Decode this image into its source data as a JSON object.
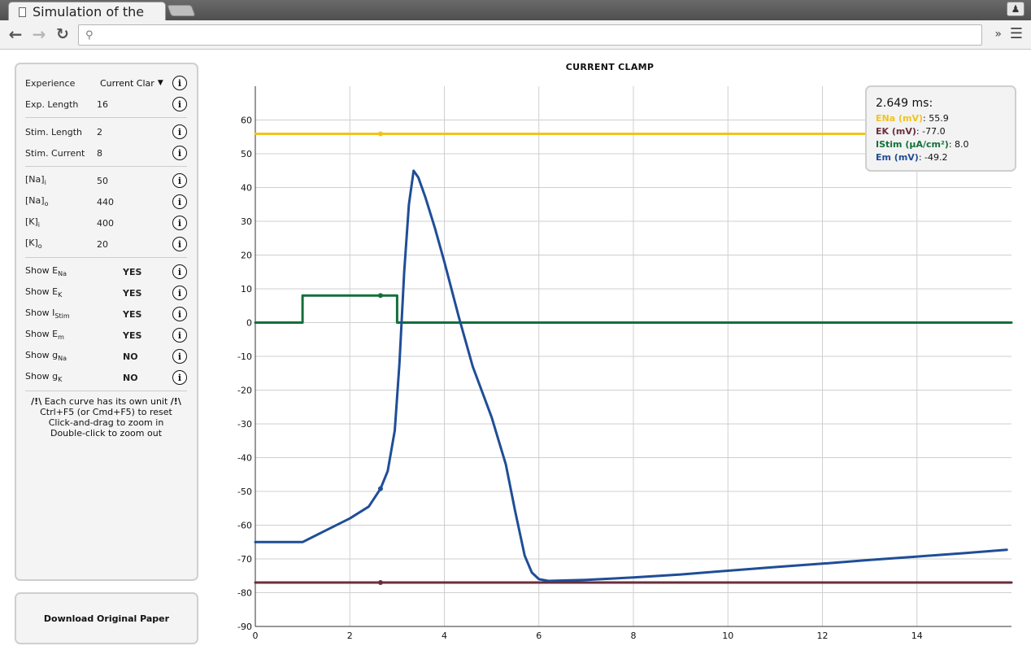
{
  "browser": {
    "tab_title": "Simulation of the ",
    "address_value": "",
    "overflow_label": "»"
  },
  "panel": {
    "experience": {
      "label": "Experience",
      "value": "Current Clar"
    },
    "exp_length": {
      "label": "Exp. Length",
      "value": "16"
    },
    "stim_length": {
      "label": "Stim. Length",
      "value": "2"
    },
    "stim_current": {
      "label": "Stim. Current",
      "value": "8"
    },
    "na_i": {
      "label": "[Na]",
      "sub": "i",
      "value": "50"
    },
    "na_o": {
      "label": "[Na]",
      "sub": "o",
      "value": "440"
    },
    "k_i": {
      "label": "[K]",
      "sub": "i",
      "value": "400"
    },
    "k_o": {
      "label": "[K]",
      "sub": "o",
      "value": "20"
    },
    "show_ena": {
      "label": "Show E",
      "sub": "Na",
      "value": "YES"
    },
    "show_ek": {
      "label": "Show E",
      "sub": "K",
      "value": "YES"
    },
    "show_istim": {
      "label": "Show I",
      "sub": "Stim",
      "value": "YES"
    },
    "show_em": {
      "label": "Show E",
      "sub": "m",
      "value": "YES"
    },
    "show_gna": {
      "label": "Show g",
      "sub": "Na",
      "value": "NO"
    },
    "show_gk": {
      "label": "Show g",
      "sub": "K",
      "value": "NO"
    },
    "notes": {
      "line1_mark_left": "/!\\",
      "line1_text": " Each curve has its own unit ",
      "line1_mark_right": "/!\\",
      "line2": "Ctrl+F5 (or Cmd+F5) to reset",
      "line3": "Click-and-drag to zoom in",
      "line4": "Double-click to zoom out"
    },
    "info_glyph": "i"
  },
  "download_label": "Download Original Paper",
  "tooltip": {
    "time": "2.649 ms:",
    "rows": [
      {
        "key": "ENa (mV)",
        "value": "55.9",
        "color": "#f2c31c"
      },
      {
        "key": "EK (mV)",
        "value": "-77.0",
        "color": "#6b2e3a"
      },
      {
        "key": "IStim (µA/cm²)",
        "value": "8.0",
        "color": "#13703a"
      },
      {
        "key": "Em (mV)",
        "value": "-49.2",
        "color": "#1f4e96"
      }
    ]
  },
  "chart_data": {
    "type": "line",
    "title": "CURRENT CLAMP",
    "xlabel": "",
    "ylabel": "",
    "xlim": [
      0,
      16
    ],
    "ylim": [
      -90,
      70
    ],
    "xticks": [
      0,
      2,
      4,
      6,
      8,
      10,
      12,
      14
    ],
    "yticks": [
      -90,
      -80,
      -70,
      -60,
      -50,
      -40,
      -30,
      -20,
      -10,
      0,
      10,
      20,
      30,
      40,
      50,
      60
    ],
    "grid": true,
    "legend": "none",
    "cursor_x": 2.649,
    "series": [
      {
        "name": "ENa (mV)",
        "color": "#f2c31c",
        "x": [
          0,
          16
        ],
        "y": [
          55.9,
          55.9
        ]
      },
      {
        "name": "EK (mV)",
        "color": "#6b2e3a",
        "x": [
          0,
          16
        ],
        "y": [
          -77.0,
          -77.0
        ]
      },
      {
        "name": "IStim (µA/cm²)",
        "color": "#13703a",
        "x": [
          0,
          1.0,
          1.0,
          3.0,
          3.0,
          16
        ],
        "y": [
          0,
          0,
          8,
          8,
          0,
          0
        ]
      },
      {
        "name": "Em (mV)",
        "color": "#1f4e96",
        "x": [
          0,
          1.0,
          1.5,
          2.0,
          2.4,
          2.649,
          2.8,
          2.95,
          3.05,
          3.15,
          3.25,
          3.35,
          3.45,
          3.6,
          3.8,
          4.0,
          4.3,
          4.6,
          5.0,
          5.3,
          5.5,
          5.7,
          5.85,
          6.0,
          6.2,
          7.0,
          8.0,
          9.0,
          10.0,
          11.0,
          12.0,
          13.0,
          14.0,
          15.0,
          15.9
        ],
        "y": [
          -65.0,
          -65.0,
          -61.5,
          -58.0,
          -54.5,
          -49.2,
          -44.0,
          -32.0,
          -12.0,
          15.0,
          35.0,
          45.0,
          43.0,
          37.0,
          28.0,
          18.0,
          2.0,
          -13.0,
          -28.0,
          -42.0,
          -56.0,
          -69.0,
          -74.0,
          -76.0,
          -76.5,
          -76.2,
          -75.5,
          -74.6,
          -73.5,
          -72.4,
          -71.4,
          -70.3,
          -69.3,
          -68.3,
          -67.3
        ]
      }
    ]
  }
}
